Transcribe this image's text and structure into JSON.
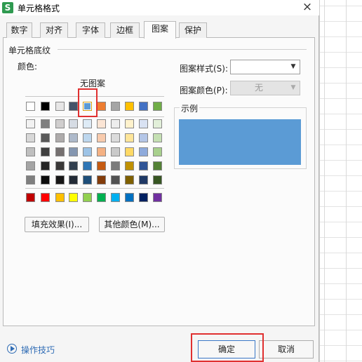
{
  "window": {
    "title": "单元格格式",
    "close": "×"
  },
  "tabs": [
    "数字",
    "对齐",
    "字体",
    "边框",
    "图案",
    "保护"
  ],
  "active_tab": "图案",
  "shading": {
    "group_title": "单元格底纹",
    "color_label": "颜色:",
    "no_pattern": "无图案",
    "selected_color": "#5b9bd5",
    "theme_row": [
      "#ffffff",
      "#000000",
      "#e7e6e6",
      "#44546a",
      "#5b9bd5",
      "#ed7d31",
      "#a5a5a5",
      "#ffc000",
      "#4472c4",
      "#70ad47"
    ],
    "tint_rows": [
      [
        "#f2f2f2",
        "#7f7f7f",
        "#d0cece",
        "#d6dce4",
        "#deebf6",
        "#fbe5d5",
        "#ededed",
        "#fff2cc",
        "#d9e2f3",
        "#e2efd9"
      ],
      [
        "#d8d8d8",
        "#595959",
        "#aeabab",
        "#adb9ca",
        "#bdd7ee",
        "#f8cbad",
        "#dbdbdb",
        "#fee599",
        "#b4c6e7",
        "#c5e0b3"
      ],
      [
        "#bfbfbf",
        "#3f3f3f",
        "#757070",
        "#8496b0",
        "#9dc3e6",
        "#f4b183",
        "#c9c9c9",
        "#ffd965",
        "#8eaadb",
        "#a8d08d"
      ],
      [
        "#a5a5a5",
        "#262626",
        "#3a3838",
        "#323f4f",
        "#2e75b5",
        "#c55a11",
        "#7b7b7b",
        "#bf9000",
        "#2f5496",
        "#538135"
      ],
      [
        "#7f7f7f",
        "#0c0c0c",
        "#171616",
        "#222a35",
        "#1e4e79",
        "#833c0b",
        "#525252",
        "#7f6000",
        "#1f3864",
        "#375623"
      ]
    ],
    "standard_row": [
      "#c00000",
      "#ff0000",
      "#ffc000",
      "#ffff00",
      "#92d050",
      "#00b050",
      "#00b0f0",
      "#0070c0",
      "#002060",
      "#7030a0"
    ],
    "fill_effects_button": "填充效果(I)...",
    "more_colors_button": "其他颜色(M)...",
    "pattern_style_label": "图案样式(S):",
    "pattern_style_value": "",
    "pattern_color_label": "图案颜色(P):",
    "pattern_color_value": "无",
    "sample_label": "示例"
  },
  "footer": {
    "tips_link": "操作技巧",
    "ok_button": "确定",
    "cancel_button": "取消"
  }
}
